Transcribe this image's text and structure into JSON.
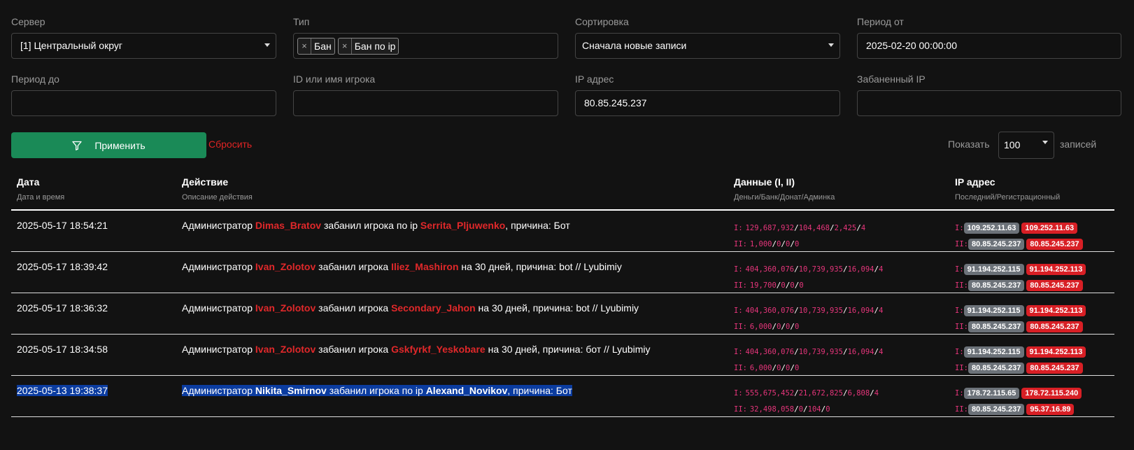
{
  "filters": {
    "server": {
      "label": "Сервер",
      "value": "[1] Центральный округ"
    },
    "type": {
      "label": "Тип",
      "tags": [
        "Бан",
        "Бан по ip"
      ]
    },
    "sort": {
      "label": "Сортировка",
      "value": "Сначала новые записи"
    },
    "period_from": {
      "label": "Период от",
      "value": "2025-02-20 00:00:00"
    },
    "period_to": {
      "label": "Период до",
      "value": ""
    },
    "player": {
      "label": "ID или имя игрока",
      "value": ""
    },
    "ip": {
      "label": "IP адрес",
      "value": "80.85.245.237"
    },
    "banned_ip": {
      "label": "Забаненный IP",
      "value": ""
    }
  },
  "actions": {
    "apply": "Применить",
    "reset": "Сбросить",
    "show": "Показать",
    "show_value": "100",
    "records": "записей"
  },
  "table": {
    "headers": [
      {
        "title": "Дата",
        "sub": "Дата и время"
      },
      {
        "title": "Действие",
        "sub": "Описание действия"
      },
      {
        "title": "Данные (I, II)",
        "sub": "Деньги/Банк/Донат/Админка"
      },
      {
        "title": "IP адрес",
        "sub": "Последний/Регистрационный"
      }
    ],
    "rows": [
      {
        "date": "2025-05-17 18:54:21",
        "action": {
          "prefix": "Администратор ",
          "admin": "Dimas_Bratov",
          "mid": " забанил игрока по ip ",
          "player": "Serrita_Pljuwenko",
          "suffix": ", причина: Бот"
        },
        "data1": [
          "129,687,932",
          "104,468",
          "2,425",
          "4"
        ],
        "data2": [
          "1,000",
          "0",
          "0",
          "0"
        ],
        "ip1": [
          "109.252.11.63",
          "109.252.11.63"
        ],
        "ip2": [
          "80.85.245.237",
          "80.85.245.237"
        ],
        "highlight": false
      },
      {
        "date": "2025-05-17 18:39:42",
        "action": {
          "prefix": "Администратор ",
          "admin": "Ivan_Zolotov",
          "mid": " забанил игрока ",
          "player": "Iliez_Mashiron",
          "suffix": " на 30 дней, причина: bot // Lyubimiy"
        },
        "data1": [
          "404,360,076",
          "10,739,935",
          "16,094",
          "4"
        ],
        "data2": [
          "19,700",
          "0",
          "0",
          "0"
        ],
        "ip1": [
          "91.194.252.115",
          "91.194.252.113"
        ],
        "ip2": [
          "80.85.245.237",
          "80.85.245.237"
        ],
        "highlight": false
      },
      {
        "date": "2025-05-17 18:36:32",
        "action": {
          "prefix": "Администратор ",
          "admin": "Ivan_Zolotov",
          "mid": " забанил игрока ",
          "player": "Secondary_Jahon",
          "suffix": " на 30 дней, причина: bot // Lyubimiy"
        },
        "data1": [
          "404,360,076",
          "10,739,935",
          "16,094",
          "4"
        ],
        "data2": [
          "6,000",
          "0",
          "0",
          "0"
        ],
        "ip1": [
          "91.194.252.115",
          "91.194.252.113"
        ],
        "ip2": [
          "80.85.245.237",
          "80.85.245.237"
        ],
        "highlight": false
      },
      {
        "date": "2025-05-17 18:34:58",
        "action": {
          "prefix": "Администратор ",
          "admin": "Ivan_Zolotov",
          "mid": " забанил игрока ",
          "player": "Gskfyrkf_Yeskobare",
          "suffix": " на 30 дней, причина: бот // Lyubimiy"
        },
        "data1": [
          "404,360,076",
          "10,739,935",
          "16,094",
          "4"
        ],
        "data2": [
          "6,000",
          "0",
          "0",
          "0"
        ],
        "ip1": [
          "91.194.252.115",
          "91.194.252.113"
        ],
        "ip2": [
          "80.85.245.237",
          "80.85.245.237"
        ],
        "highlight": false
      },
      {
        "date": "2025-05-13 19:38:37",
        "action": {
          "prefix": "Администратор ",
          "admin": "Nikita_Smirnov",
          "mid": " забанил игрока по ip ",
          "player": "Alexand_Novikov",
          "suffix": ", причина: Бот"
        },
        "data1": [
          "555,675,452",
          "21,672,825",
          "6,808",
          "4"
        ],
        "data2": [
          "32,498,058",
          "0",
          "104",
          "0"
        ],
        "ip1": [
          "178.72.115.65",
          "178.72.115.240"
        ],
        "ip2": [
          "80.85.245.237",
          "95.37.16.89"
        ],
        "highlight": true
      }
    ],
    "row_labels": {
      "first": "I:",
      "second": "II:"
    }
  },
  "colors": {
    "accent_green": "#1a8a57",
    "reset_red": "#e02424",
    "name_red": "#e0282a",
    "data_pink": "#e6357b",
    "badge_gray": "#6c7279",
    "badge_red": "#d81f25",
    "selection": "#0b3ca0"
  }
}
